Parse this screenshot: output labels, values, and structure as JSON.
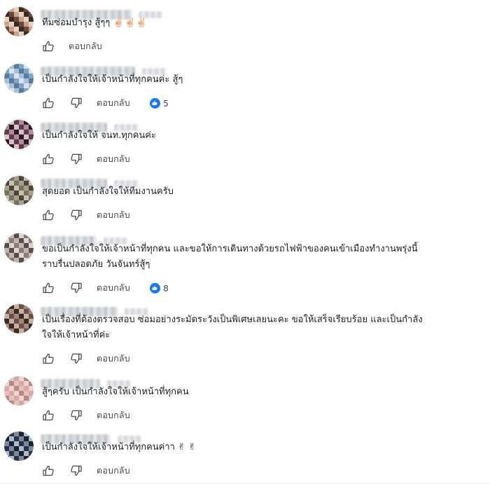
{
  "reply_label": "ตอบกลับ",
  "comments": [
    {
      "text_lines": [
        "ทีมซ่อมบำรุง สู้ๆๆ ✌🏻✌🏻✌🏻"
      ],
      "has_dislike": false,
      "reaction_count": null,
      "avatar_colors": [
        "#6b4a3a",
        "#c9a48b",
        "#e6d0c0",
        "#3c2b22"
      ]
    },
    {
      "text_lines": [
        "เป็นกำลังใจให้เจ้าหน้าที่ทุกคนค่ะ สู้ๆ"
      ],
      "has_dislike": true,
      "reaction_count": "5",
      "avatar_colors": [
        "#7fa4c8",
        "#d7e3ee",
        "#a9c1d8",
        "#5a7a9a"
      ]
    },
    {
      "text_lines": [
        "เป็นกำลังใจให้ จนท.ทุกคนค่ะ"
      ],
      "has_dislike": true,
      "reaction_count": null,
      "avatar_colors": [
        "#5b3a4a",
        "#b48a9a",
        "#2a1c24",
        "#d7c0c8"
      ]
    },
    {
      "text_lines": [
        "สุดยอด เป็นกำลังใจให้ทีมงานครับ"
      ],
      "has_dislike": true,
      "reaction_count": null,
      "avatar_colors": [
        "#7a7060",
        "#a89f8c",
        "#4c463c",
        "#c8c0ae"
      ]
    },
    {
      "text_lines": [
        "ขอเป็นกำลังใจให้เจ้าหน้าที่ทุกคน และขอให้การเดินทางด้วยรถไฟฟ้าของคนเข้าเมืองทำงานพรุ่งนี้",
        "ราบรื่นปลอดภัย วันจันทร์สู้ๆ"
      ],
      "has_dislike": true,
      "reaction_count": "8",
      "avatar_colors": [
        "#8a7a78",
        "#c4b4b0",
        "#5a4c4a",
        "#e0d4d0"
      ]
    },
    {
      "text_lines": [
        "เป็นเรื่องที่ต้องตรวจสอบ ซ่อมอย่างระมัดระวังเป็นพิเศษเลยนะคะ ขอให้เสร็จเรียบร้อย และเป็นกำลัง",
        "ใจให้เจ้าหน้าที่ค่ะ"
      ],
      "has_dislike": true,
      "reaction_count": null,
      "avatar_colors": [
        "#6a5048",
        "#a88878",
        "#3a2a24",
        "#c8b0a0"
      ]
    },
    {
      "text_lines": [
        "สู้ๆครับ เป็นกำลังใจให้เจ้าหน้าที่ทุกคน"
      ],
      "has_dislike": true,
      "reaction_count": null,
      "avatar_colors": [
        "#d8a8a8",
        "#f0d4d0",
        "#b88888",
        "#e8c0bc"
      ]
    },
    {
      "text_lines": [
        "เป็นกำลังใจให้เจ้าหน้าที่ทุกคนค่าา ✌ ✌"
      ],
      "has_dislike": true,
      "reaction_count": null,
      "avatar_colors": [
        "#2a3444",
        "#7a8aa0",
        "#1a2230",
        "#b0bccc"
      ]
    }
  ]
}
